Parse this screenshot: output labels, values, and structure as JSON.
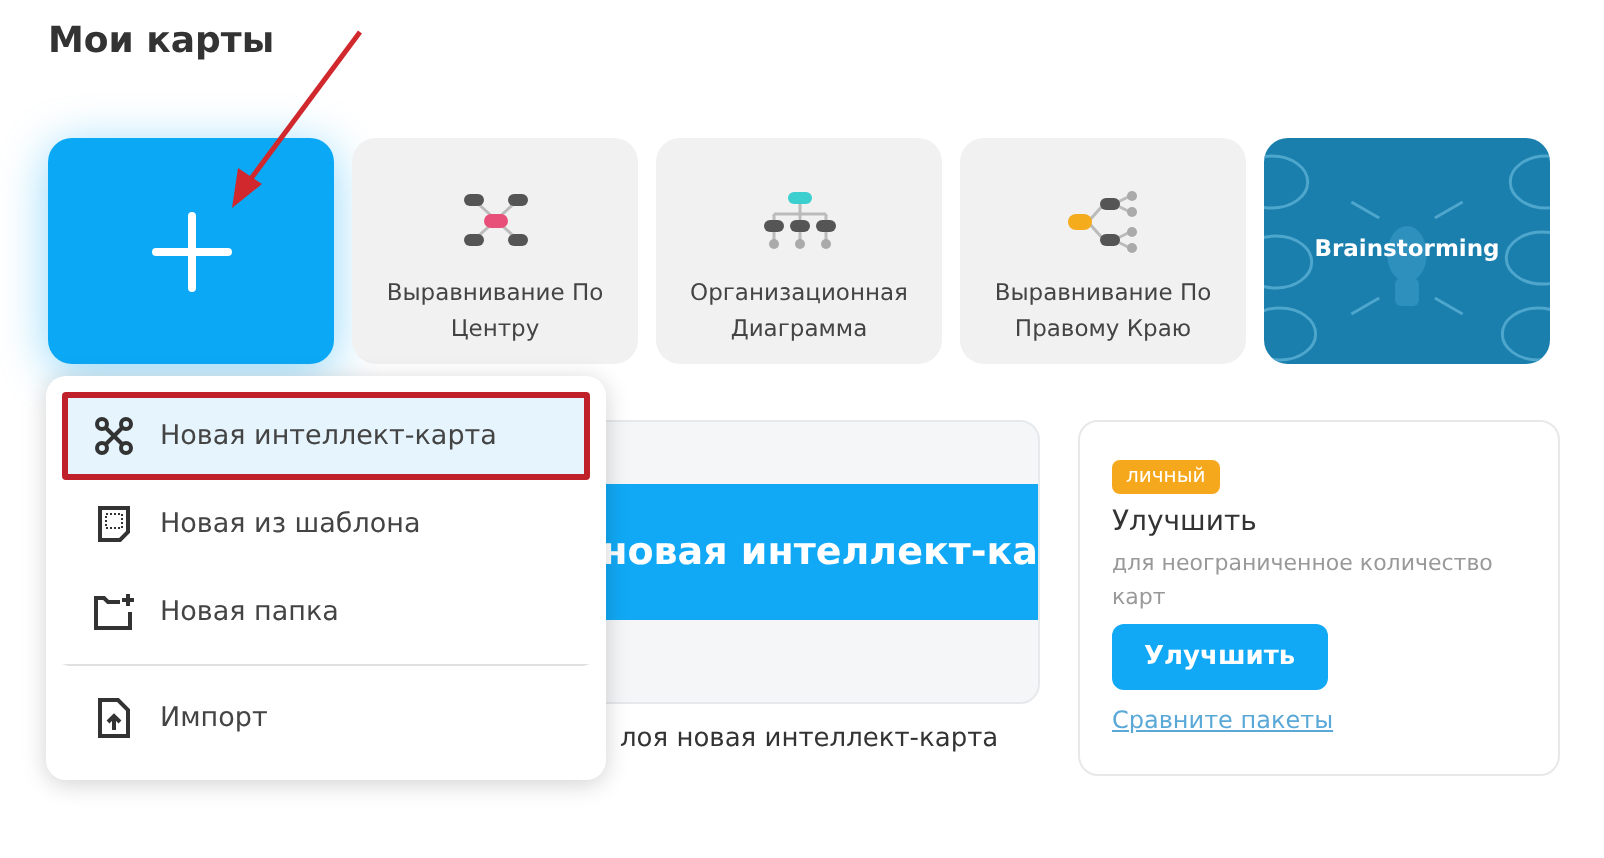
{
  "title": "Мои карты",
  "annotation_arrow": true,
  "tiles": [
    {
      "kind": "new"
    },
    {
      "kind": "center",
      "label": "Выравнивание По Центру"
    },
    {
      "kind": "org",
      "label": "Организационная Диаграмма"
    },
    {
      "kind": "right",
      "label": "Выравнивание По Правому Краю"
    },
    {
      "kind": "picture",
      "label": "Brainstorming"
    }
  ],
  "preview": {
    "banner": "новая интеллект-ка",
    "caption": "лоя новая интеллект-карта"
  },
  "menu": [
    {
      "kind": "mindmap",
      "label": "Новая интеллект-карта",
      "selected": true,
      "framed": true,
      "separated": false
    },
    {
      "kind": "template",
      "label": "Новая из шаблона",
      "selected": false,
      "framed": false,
      "separated": false
    },
    {
      "kind": "folder",
      "label": "Новая папка",
      "selected": false,
      "framed": false,
      "separated": false
    },
    {
      "kind": "import",
      "label": "Импорт",
      "selected": false,
      "framed": false,
      "separated": true
    }
  ],
  "upgrade": {
    "badge": "личный",
    "heading": "Улучшить",
    "text": "для неограниченное количество карт",
    "button": "Улучшить",
    "link": "Сравните пакеты"
  }
}
